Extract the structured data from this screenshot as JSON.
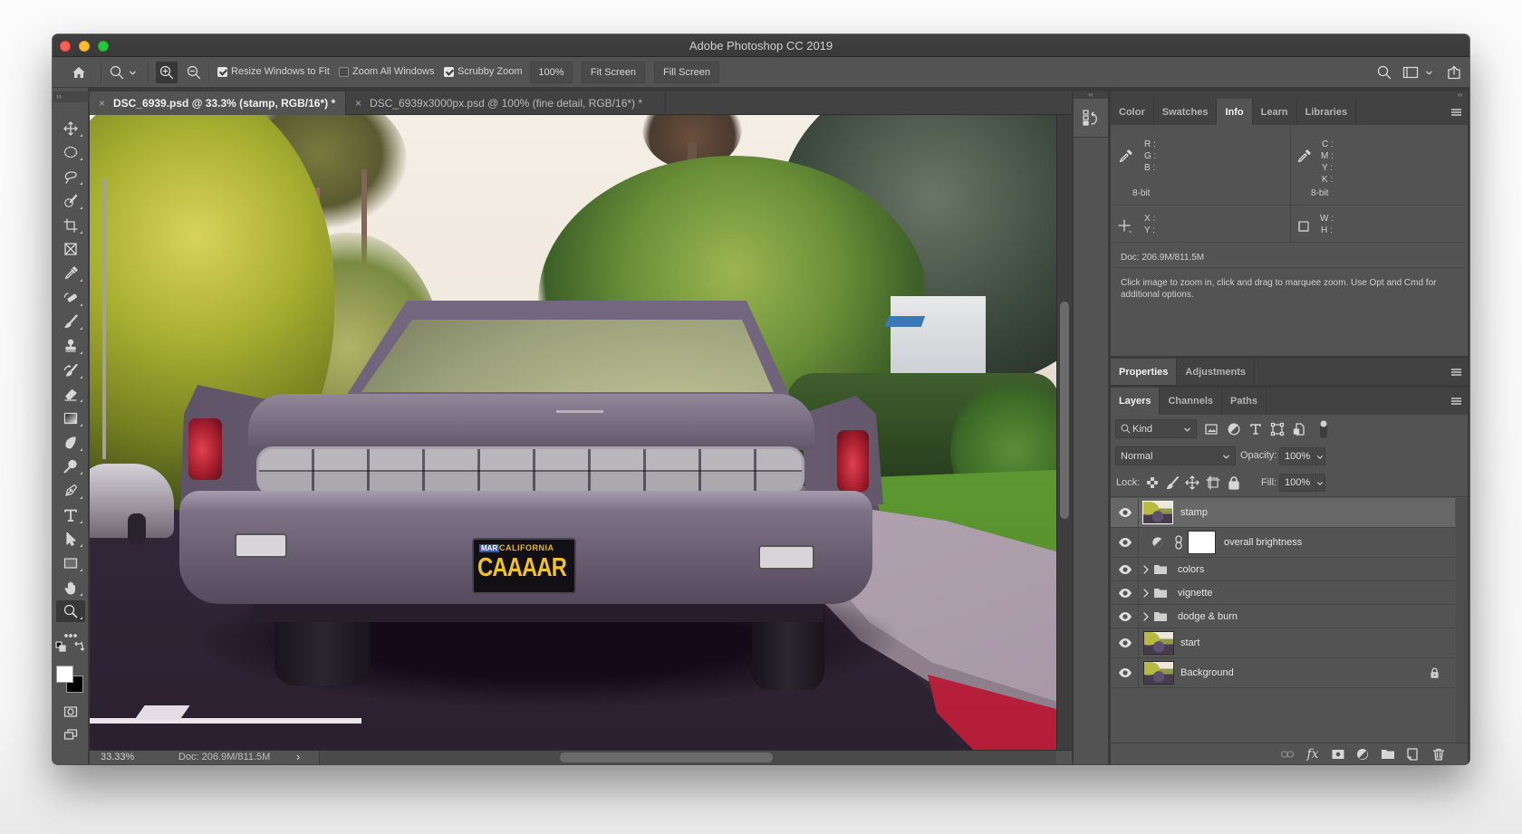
{
  "window": {
    "title": "Adobe Photoshop CC 2019"
  },
  "options_bar": {
    "icons": [
      "home-icon",
      "zoom-tool-preset-icon",
      "chevron-down-icon",
      "zoom-in-icon",
      "zoom-out-icon"
    ],
    "zoom_in_active": true,
    "resize_windows_to_fit": {
      "label": "Resize Windows to Fit",
      "checked": true
    },
    "zoom_all_windows": {
      "label": "Zoom All Windows",
      "checked": false
    },
    "scrubby_zoom": {
      "label": "Scrubby Zoom",
      "checked": true
    },
    "zoom_level": "100%",
    "fit_screen": "Fit Screen",
    "fill_screen": "Fill Screen",
    "right_icons": [
      "search-icon",
      "workspace-icon",
      "chevron-down-icon",
      "share-icon"
    ]
  },
  "document_tabs": [
    {
      "label": "DSC_6939.psd @ 33.3% (stamp, RGB/16*) *",
      "close": "×",
      "active": true
    },
    {
      "label": "DSC_6939x3000px.psd @ 100% (fine detail, RGB/16*) *",
      "close": "×",
      "active": false
    }
  ],
  "tools_panel": {
    "expand": "››",
    "active_tool": "zoom",
    "tools": [
      {
        "icon": "move-icon"
      },
      {
        "icon": "elliptical-marquee-icon"
      },
      {
        "icon": "lasso-icon"
      },
      {
        "icon": "quick-selection-icon"
      },
      {
        "icon": "crop-icon"
      },
      {
        "icon": "frame-icon"
      },
      {
        "icon": "eyedropper-icon"
      },
      {
        "icon": "spot-healing-brush-icon"
      },
      {
        "icon": "brush-icon"
      },
      {
        "icon": "clone-stamp-icon"
      },
      {
        "icon": "history-brush-icon"
      },
      {
        "icon": "eraser-icon"
      },
      {
        "icon": "gradient-icon"
      },
      {
        "icon": "blur-icon"
      },
      {
        "icon": "dodge-icon"
      },
      {
        "icon": "pen-icon"
      },
      {
        "icon": "type-icon"
      },
      {
        "icon": "path-selection-icon"
      },
      {
        "icon": "rectangle-icon"
      },
      {
        "icon": "hand-icon"
      },
      {
        "icon": "zoom-icon",
        "active": true
      },
      {
        "icon": "edit-toolbar-icon"
      },
      {
        "icon": "default-colors-icon"
      },
      {
        "icon": "swap-colors-icon"
      },
      {
        "icon": "quick-mask-icon"
      },
      {
        "icon": "screen-mode-icon"
      }
    ],
    "foreground_color": "#ffffff",
    "background_color": "#000000"
  },
  "canvas": {
    "plate": {
      "month": "MAR",
      "state": "CALIFORNIA",
      "number": "CAAAAR"
    }
  },
  "status_bar": {
    "zoom": "33.33%",
    "doc_size": "Doc: 206.9M/811.5M",
    "menu_arrow": "›"
  },
  "dock": {
    "collapse": "‹‹",
    "expand": "››",
    "collapsed_panels": [
      "history-icon"
    ]
  },
  "info_panel": {
    "tabs": [
      {
        "label": "Color",
        "active": false
      },
      {
        "label": "Swatches",
        "active": false
      },
      {
        "label": "Info",
        "active": true
      },
      {
        "label": "Learn",
        "active": false
      },
      {
        "label": "Libraries",
        "active": false
      }
    ],
    "rgb": {
      "labels": [
        "R :",
        "G :",
        "B :"
      ],
      "bit_depth": "8-bit"
    },
    "cmyk": {
      "labels": [
        "C :",
        "M :",
        "Y :",
        "K :"
      ],
      "bit_depth": "8-bit"
    },
    "position": {
      "labels": [
        "X :",
        "Y :"
      ]
    },
    "size": {
      "labels": [
        "W :",
        "H :"
      ]
    },
    "doc": "Doc: 206.9M/811.5M",
    "help": "Click image to zoom in, click and drag to marquee zoom.  Use Opt and Cmd for additional options."
  },
  "properties_panel": {
    "tabs": [
      {
        "label": "Properties",
        "active": true
      },
      {
        "label": "Adjustments",
        "active": false
      }
    ]
  },
  "layers_panel": {
    "tabs": [
      {
        "label": "Layers",
        "active": true
      },
      {
        "label": "Channels",
        "active": false
      },
      {
        "label": "Paths",
        "active": false
      }
    ],
    "filter_kind": "Kind",
    "blend_mode": "Normal",
    "opacity_label": "Opacity:",
    "opacity": "100%",
    "lock_label": "Lock:",
    "fill_label": "Fill:",
    "fill": "100%",
    "layers": [
      {
        "name": "stamp",
        "type": "pixel",
        "visible": true,
        "selected": true
      },
      {
        "name": "overall brightness",
        "type": "adjustment",
        "visible": true,
        "selected": false
      },
      {
        "name": "colors",
        "type": "group",
        "visible": true,
        "selected": false
      },
      {
        "name": "vignette",
        "type": "group",
        "visible": true,
        "selected": false
      },
      {
        "name": "dodge & burn",
        "type": "group",
        "visible": true,
        "selected": false
      },
      {
        "name": "start",
        "type": "pixel",
        "visible": true,
        "selected": false
      },
      {
        "name": "Background",
        "type": "pixel",
        "visible": true,
        "selected": false,
        "locked": true
      }
    ],
    "footer": {
      "fx_label": "fx"
    }
  },
  "colors": {
    "panel": "#535353",
    "panel_dark": "#424242",
    "canvas_bg": "#282828",
    "selected_layer": "#676767",
    "close": "#fe5f57",
    "minimize": "#febc2e",
    "maximize": "#28c840"
  }
}
